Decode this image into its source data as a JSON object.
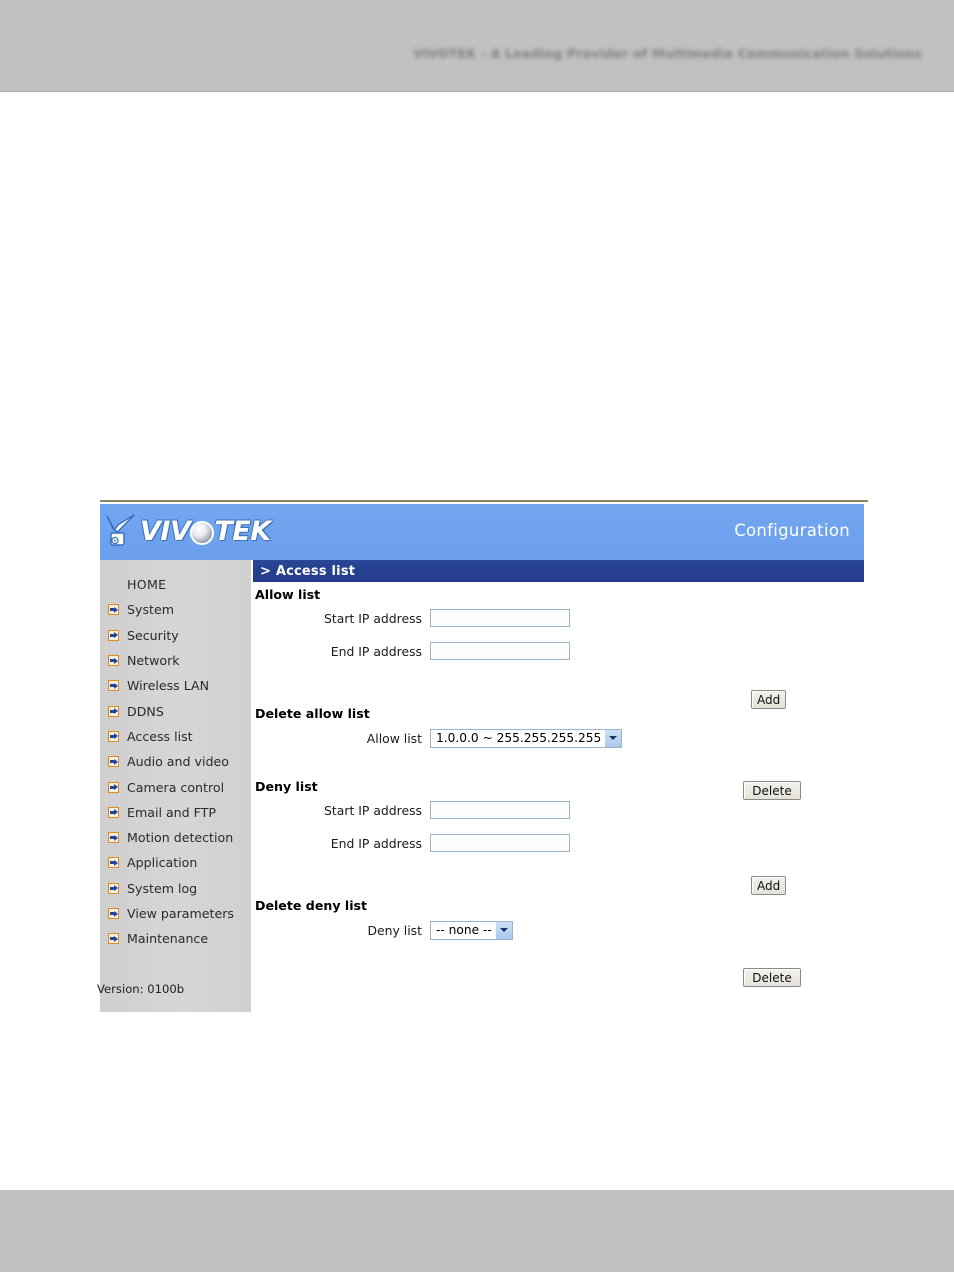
{
  "page": {
    "banner_text": "VIVOTEK - A Leading Provider of Multimedia Communication Solutions"
  },
  "device_ui": {
    "brand_pre": "VIV",
    "brand_post": "TEK",
    "brand_full": "VIVOTEK",
    "masthead_title": "Configuration",
    "breadcrumb": "> Access list",
    "version": "Version: 0100b"
  },
  "sidebar": {
    "items": [
      {
        "label": "HOME",
        "has_bullet": false
      },
      {
        "label": "System",
        "has_bullet": true
      },
      {
        "label": "Security",
        "has_bullet": true
      },
      {
        "label": "Network",
        "has_bullet": true
      },
      {
        "label": "Wireless LAN",
        "has_bullet": true
      },
      {
        "label": "DDNS",
        "has_bullet": true
      },
      {
        "label": "Access list",
        "has_bullet": true
      },
      {
        "label": "Audio and video",
        "has_bullet": true
      },
      {
        "label": "Camera control",
        "has_bullet": true
      },
      {
        "label": "Email and FTP",
        "has_bullet": true
      },
      {
        "label": "Motion detection",
        "has_bullet": true
      },
      {
        "label": "Application",
        "has_bullet": true
      },
      {
        "label": "System log",
        "has_bullet": true
      },
      {
        "label": "View parameters",
        "has_bullet": true
      },
      {
        "label": "Maintenance",
        "has_bullet": true
      }
    ]
  },
  "form": {
    "allow_list": {
      "heading": "Allow list",
      "start_ip_label": "Start IP address",
      "start_ip_value": "",
      "end_ip_label": "End IP address",
      "end_ip_value": "",
      "add_button": "Add"
    },
    "delete_allow_list": {
      "heading": "Delete allow list",
      "select_label": "Allow list",
      "selected_option": "1.0.0.0 ~ 255.255.255.255",
      "delete_button": "Delete"
    },
    "deny_list": {
      "heading": "Deny list",
      "start_ip_label": "Start IP address",
      "start_ip_value": "",
      "end_ip_label": "End IP address",
      "end_ip_value": "",
      "add_button": "Add"
    },
    "delete_deny_list": {
      "heading": "Delete deny list",
      "select_label": "Deny list",
      "selected_option": "-- none --",
      "delete_button": "Delete"
    }
  },
  "colors": {
    "page_gray": "#c0c2c1",
    "masthead_blue": "#6fa3ee",
    "crumb_blue": "#243f8f",
    "sidebar_gray": "#d3d3d3",
    "bullet_orange": "#e08a1e",
    "bullet_arrow_blue": "#23439c"
  }
}
